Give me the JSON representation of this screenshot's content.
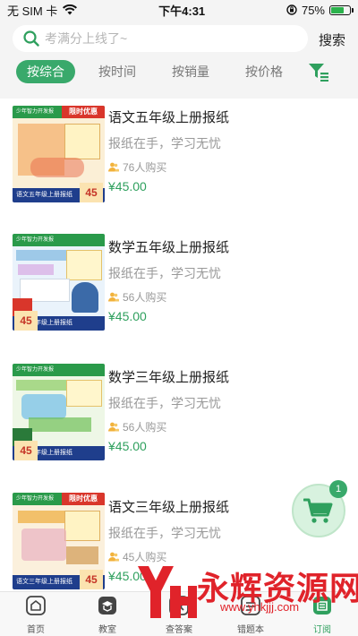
{
  "status_bar": {
    "carrier": "无 SIM 卡",
    "time": "下午4:31",
    "battery": "75%",
    "battery_level": 0.75
  },
  "search": {
    "placeholder": "考满分上线了~",
    "button_label": "搜索"
  },
  "sort_tabs": [
    {
      "label": "按综合",
      "active": true
    },
    {
      "label": "按时间",
      "active": false
    },
    {
      "label": "按销量",
      "active": false
    },
    {
      "label": "按价格",
      "active": false
    }
  ],
  "filter_icon": "filter-icon",
  "products": [
    {
      "title": "语文五年级上册报纸",
      "subtitle": "报纸在手，学习无忧",
      "buyers": "76人购买",
      "price": "¥45.00",
      "cover": {
        "top_tag": "少年智力开发报",
        "promo": "限时优惠",
        "bottom": "语文五年级上册报纸",
        "price": "45",
        "accent": "#f29a4a"
      }
    },
    {
      "title": "数学五年级上册报纸",
      "subtitle": "报纸在手，学习无忧",
      "buyers": "56人购买",
      "price": "¥45.00",
      "cover": {
        "top_tag": "少年智力开发报",
        "promo": "",
        "bottom": "数学五年级上册报纸",
        "price": "45",
        "accent": "#9ec9e8"
      }
    },
    {
      "title": "数学三年级上册报纸",
      "subtitle": "报纸在手，学习无忧",
      "buyers": "56人购买",
      "price": "¥45.00",
      "cover": {
        "top_tag": "少年智力开发报",
        "promo": "",
        "bottom": "数学三年级上册报纸",
        "price": "45",
        "accent": "#a9d98a"
      }
    },
    {
      "title": "语文三年级上册报纸",
      "subtitle": "报纸在手，学习无忧",
      "buyers": "45人购买",
      "price": "¥45.00",
      "cover": {
        "top_tag": "少年智力开发报",
        "promo": "限时优惠",
        "bottom": "语文三年级上册报纸",
        "price": "45",
        "accent": "#f2c06a"
      }
    }
  ],
  "cart": {
    "count": "1"
  },
  "bottom_nav": [
    {
      "label": "首页",
      "icon": "home-icon",
      "active": false
    },
    {
      "label": "教室",
      "icon": "classroom-icon",
      "active": false
    },
    {
      "label": "查答案",
      "icon": "answers-icon",
      "active": false
    },
    {
      "label": "错题本",
      "icon": "notebook-icon",
      "active": false
    },
    {
      "label": "订阅",
      "icon": "subscribe-icon",
      "active": true
    }
  ],
  "watermark": {
    "text": "永辉资源网",
    "url": "www.yhkjjj.com"
  },
  "colors": {
    "brand_green": "#39a96b",
    "price_green": "#2fa05e",
    "promo_red": "#d9362b"
  }
}
